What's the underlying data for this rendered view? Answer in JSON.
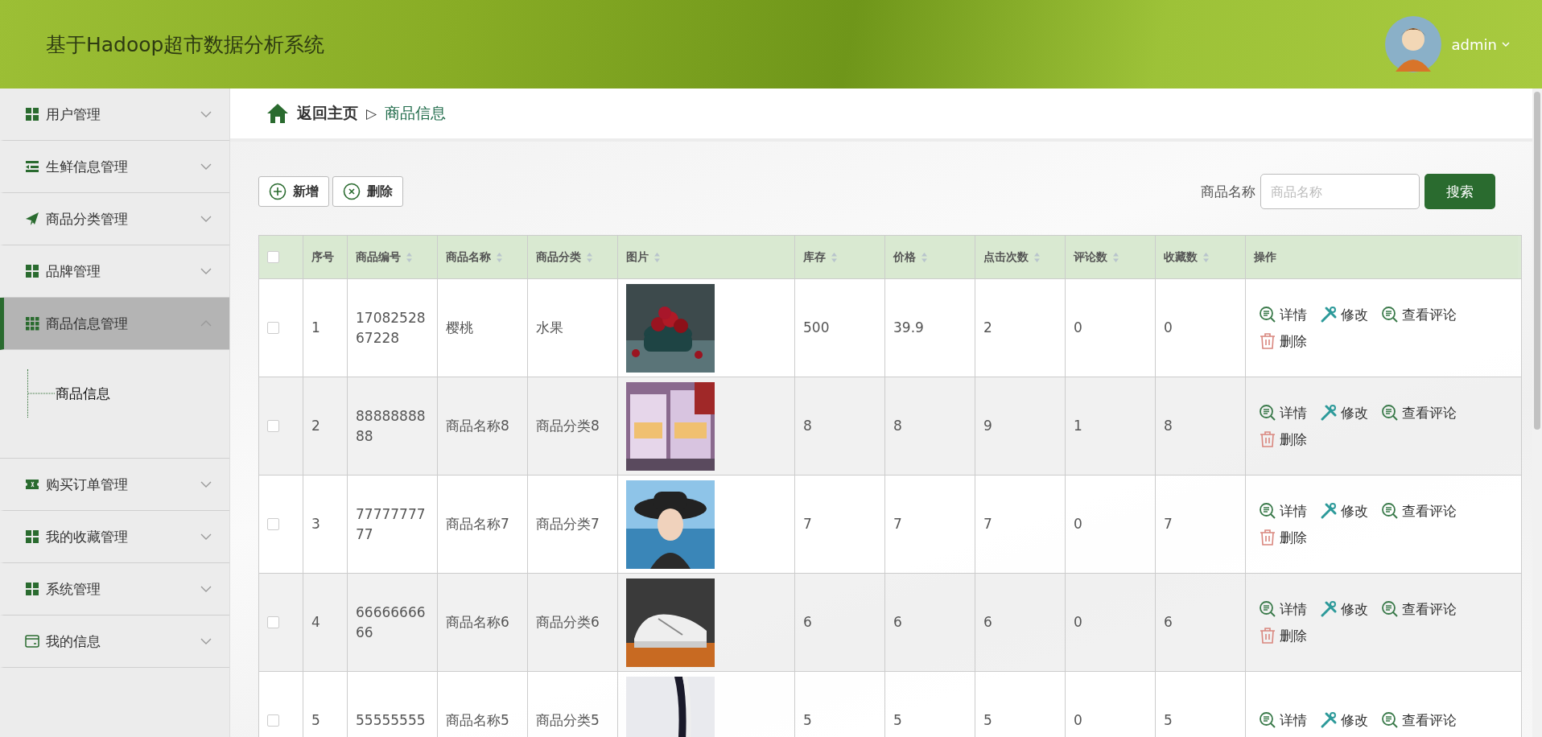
{
  "header": {
    "title": "基于Hadoop超市数据分析系统",
    "user": "admin"
  },
  "sidebar": {
    "items": [
      {
        "label": "用户管理",
        "kind": "grid",
        "expanded": false,
        "selected": false
      },
      {
        "label": "生鲜信息管理",
        "kind": "list",
        "expanded": false,
        "selected": false
      },
      {
        "label": "商品分类管理",
        "kind": "plane",
        "expanded": false,
        "selected": false
      },
      {
        "label": "品牌管理",
        "kind": "grid",
        "expanded": false,
        "selected": false
      },
      {
        "label": "商品信息管理",
        "kind": "grid9",
        "expanded": true,
        "selected": true,
        "children": [
          {
            "label": "商品信息",
            "selected": true
          }
        ]
      },
      {
        "label": "购买订单管理",
        "kind": "ticket",
        "expanded": false,
        "selected": false
      },
      {
        "label": "我的收藏管理",
        "kind": "grid",
        "expanded": false,
        "selected": false
      },
      {
        "label": "系统管理",
        "kind": "grid",
        "expanded": false,
        "selected": false
      },
      {
        "label": "我的信息",
        "kind": "card",
        "expanded": false,
        "selected": false
      }
    ]
  },
  "breadcrumb": {
    "home": "返回主页",
    "separator": "▷",
    "current": "商品信息"
  },
  "toolbar": {
    "buttons": [
      {
        "label": "新增",
        "kind": "add"
      },
      {
        "label": "删除",
        "kind": "delete"
      }
    ],
    "search_label": "商品名称",
    "search_placeholder": "商品名称",
    "search_button": "搜索"
  },
  "table": {
    "select_all": {
      "checked": false
    },
    "columns": [
      {
        "label": "序号",
        "sortable": false
      },
      {
        "label": "商品编号",
        "sortable": true
      },
      {
        "label": "商品名称",
        "sortable": true
      },
      {
        "label": "商品分类",
        "sortable": true
      },
      {
        "label": "图片",
        "sortable": true
      },
      {
        "label": "库存",
        "sortable": true
      },
      {
        "label": "价格",
        "sortable": true
      },
      {
        "label": "点击次数",
        "sortable": true
      },
      {
        "label": "评论数",
        "sortable": true
      },
      {
        "label": "收藏数",
        "sortable": true
      },
      {
        "label": "操作",
        "sortable": false
      }
    ],
    "rows": [
      {
        "checked": false,
        "cells": [
          "1",
          "1708252867228",
          "樱桃",
          "水果"
        ],
        "image": {
          "kind": "picture"
        },
        "stats": [
          "500",
          "39.9",
          "2",
          "0",
          "0"
        ],
        "actions": [
          {
            "label": "详情",
            "kind": "detail"
          },
          {
            "label": "修改",
            "kind": "edit"
          },
          {
            "label": "查看评论",
            "kind": "detail"
          },
          {
            "label": "删除",
            "kind": "delete"
          }
        ]
      },
      {
        "checked": false,
        "cells": [
          "2",
          "8888888888",
          "商品名称8",
          "商品分类8"
        ],
        "image": {
          "kind": "picture"
        },
        "stats": [
          "8",
          "8",
          "9",
          "1",
          "8"
        ],
        "actions": [
          {
            "label": "详情",
            "kind": "detail"
          },
          {
            "label": "修改",
            "kind": "edit"
          },
          {
            "label": "查看评论",
            "kind": "detail"
          },
          {
            "label": "删除",
            "kind": "delete"
          }
        ]
      },
      {
        "checked": false,
        "cells": [
          "3",
          "7777777777",
          "商品名称7",
          "商品分类7"
        ],
        "image": {
          "kind": "picture"
        },
        "stats": [
          "7",
          "7",
          "7",
          "0",
          "7"
        ],
        "actions": [
          {
            "label": "详情",
            "kind": "detail"
          },
          {
            "label": "修改",
            "kind": "edit"
          },
          {
            "label": "查看评论",
            "kind": "detail"
          },
          {
            "label": "删除",
            "kind": "delete"
          }
        ]
      },
      {
        "checked": false,
        "cells": [
          "4",
          "6666666666",
          "商品名称6",
          "商品分类6"
        ],
        "image": {
          "kind": "picture"
        },
        "stats": [
          "6",
          "6",
          "6",
          "0",
          "6"
        ],
        "actions": [
          {
            "label": "详情",
            "kind": "detail"
          },
          {
            "label": "修改",
            "kind": "edit"
          },
          {
            "label": "查看评论",
            "kind": "detail"
          },
          {
            "label": "删除",
            "kind": "delete"
          }
        ]
      },
      {
        "checked": false,
        "cells": [
          "5",
          "55555555",
          "商品名称5",
          "商品分类5"
        ],
        "image": {
          "kind": "picture"
        },
        "stats": [
          "5",
          "5",
          "5",
          "0",
          "5"
        ],
        "actions": [
          {
            "label": "详情",
            "kind": "detail"
          },
          {
            "label": "修改",
            "kind": "edit"
          },
          {
            "label": "查看评论",
            "kind": "detail"
          }
        ]
      }
    ]
  }
}
